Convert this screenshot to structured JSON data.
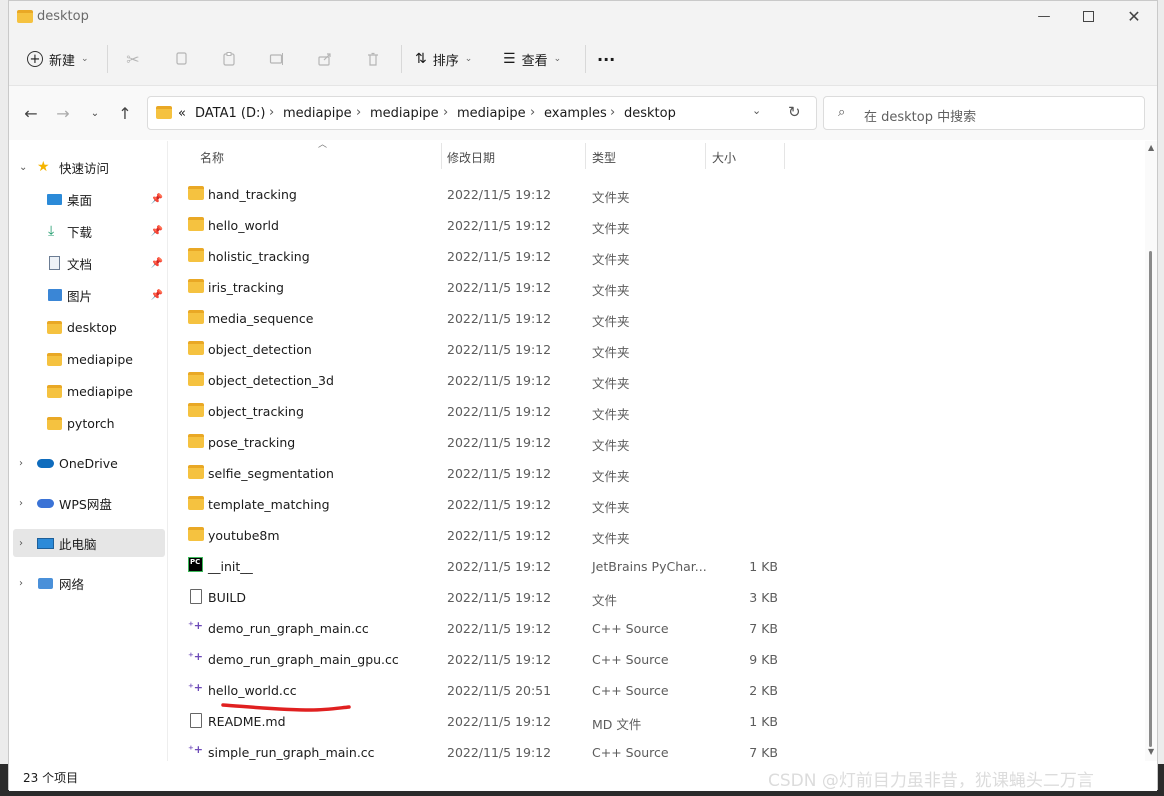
{
  "window": {
    "title": "desktop",
    "controls": [
      "minimize-icon",
      "maximize-icon",
      "close-icon"
    ]
  },
  "toolbar": {
    "new_label": "新建",
    "sort_label": "排序",
    "view_label": "查看",
    "more_label": "···"
  },
  "address": {
    "prefix": "«",
    "crumbs": [
      "DATA1 (D:)",
      "mediapipe",
      "mediapipe",
      "mediapipe",
      "examples",
      "desktop"
    ],
    "sep": "›"
  },
  "search": {
    "placeholder": "在 desktop 中搜索"
  },
  "sidebar": {
    "quick_access": "快速访问",
    "pinned": [
      "桌面",
      "下载",
      "文档",
      "图片"
    ],
    "recent": [
      "desktop",
      "mediapipe",
      "mediapipe",
      "pytorch"
    ],
    "onedrive": "OneDrive",
    "wps": "WPS网盘",
    "this_pc": "此电脑",
    "network": "网络"
  },
  "columns": {
    "name": "名称",
    "date": "修改日期",
    "type": "类型",
    "size": "大小"
  },
  "files": [
    {
      "name": "hand_tracking",
      "date": "2022/11/5 19:12",
      "type": "文件夹",
      "size": "",
      "icon": "folder-icon"
    },
    {
      "name": "hello_world",
      "date": "2022/11/5 19:12",
      "type": "文件夹",
      "size": "",
      "icon": "folder-icon"
    },
    {
      "name": "holistic_tracking",
      "date": "2022/11/5 19:12",
      "type": "文件夹",
      "size": "",
      "icon": "folder-icon"
    },
    {
      "name": "iris_tracking",
      "date": "2022/11/5 19:12",
      "type": "文件夹",
      "size": "",
      "icon": "folder-icon"
    },
    {
      "name": "media_sequence",
      "date": "2022/11/5 19:12",
      "type": "文件夹",
      "size": "",
      "icon": "folder-icon"
    },
    {
      "name": "object_detection",
      "date": "2022/11/5 19:12",
      "type": "文件夹",
      "size": "",
      "icon": "folder-icon"
    },
    {
      "name": "object_detection_3d",
      "date": "2022/11/5 19:12",
      "type": "文件夹",
      "size": "",
      "icon": "folder-icon"
    },
    {
      "name": "object_tracking",
      "date": "2022/11/5 19:12",
      "type": "文件夹",
      "size": "",
      "icon": "folder-icon"
    },
    {
      "name": "pose_tracking",
      "date": "2022/11/5 19:12",
      "type": "文件夹",
      "size": "",
      "icon": "folder-icon"
    },
    {
      "name": "selfie_segmentation",
      "date": "2022/11/5 19:12",
      "type": "文件夹",
      "size": "",
      "icon": "folder-icon"
    },
    {
      "name": "template_matching",
      "date": "2022/11/5 19:12",
      "type": "文件夹",
      "size": "",
      "icon": "folder-icon"
    },
    {
      "name": "youtube8m",
      "date": "2022/11/5 19:12",
      "type": "文件夹",
      "size": "",
      "icon": "folder-icon"
    },
    {
      "name": "__init__",
      "date": "2022/11/5 19:12",
      "type": "JetBrains PyChar...",
      "size": "1 KB",
      "icon": "pycharm-icon"
    },
    {
      "name": "BUILD",
      "date": "2022/11/5 19:12",
      "type": "文件",
      "size": "3 KB",
      "icon": "file-icon"
    },
    {
      "name": "demo_run_graph_main.cc",
      "date": "2022/11/5 19:12",
      "type": "C++ Source",
      "size": "7 KB",
      "icon": "cpp-icon"
    },
    {
      "name": "demo_run_graph_main_gpu.cc",
      "date": "2022/11/5 19:12",
      "type": "C++ Source",
      "size": "9 KB",
      "icon": "cpp-icon"
    },
    {
      "name": "hello_world.cc",
      "date": "2022/11/5 20:51",
      "type": "C++ Source",
      "size": "2 KB",
      "icon": "cpp-icon"
    },
    {
      "name": "README.md",
      "date": "2022/11/5 19:12",
      "type": "MD 文件",
      "size": "1 KB",
      "icon": "file-icon"
    },
    {
      "name": "simple_run_graph_main.cc",
      "date": "2022/11/5 19:12",
      "type": "C++ Source",
      "size": "7 KB",
      "icon": "cpp-icon"
    }
  ],
  "status": {
    "count": "23 个项目"
  },
  "watermark": "CSDN @灯前目力虽非昔，犹课蝇头二万言",
  "colors": {
    "folder": "#f5c240",
    "accent": "#0067c0",
    "annotation": "#e02020"
  }
}
